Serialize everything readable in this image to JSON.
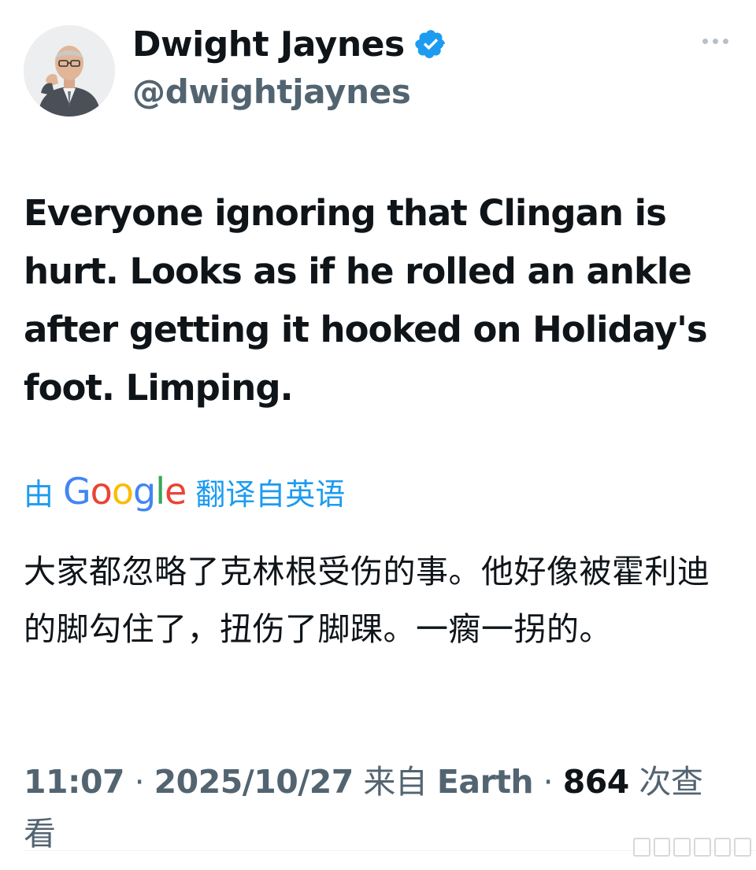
{
  "author": {
    "display_name": "Dwight Jaynes",
    "handle": "@dwightjaynes",
    "verified": true,
    "avatar_icon": "avatar-photo"
  },
  "tweet": {
    "text": "Everyone ignoring that Clingan is hurt. Looks as if he rolled an ankle after getting it hooked on Holiday's foot. Limping."
  },
  "translation": {
    "prefix": "由",
    "provider_logo": "Google",
    "suffix": "翻译自英语",
    "text": "大家都忽略了克林根受伤的事。他好像被霍利迪的脚勾住了，扭伤了脚踝。一瘸一拐的。"
  },
  "meta": {
    "time": "11:07",
    "separator": "·",
    "date": "2025/10/27",
    "source_prefix": "来自",
    "location": "Earth",
    "views_count": "864",
    "views_label": "次查看"
  },
  "colors": {
    "link": "#1d9bf0",
    "secondary_text": "#536471",
    "primary_text": "#0f1419",
    "verified_badge": "#1d9bf0"
  }
}
